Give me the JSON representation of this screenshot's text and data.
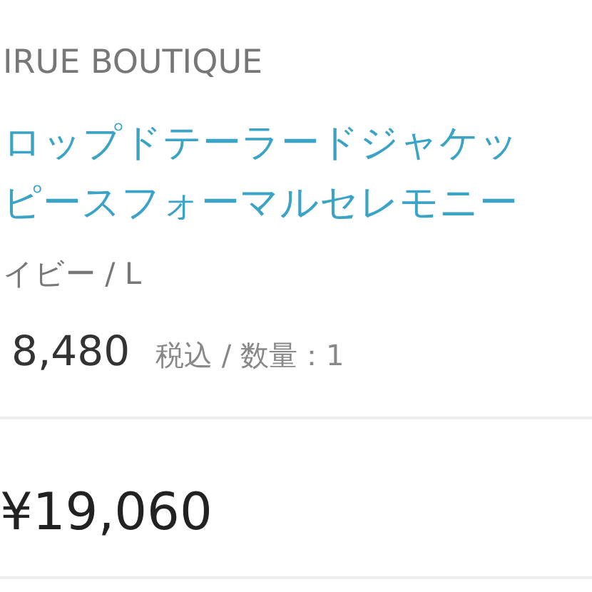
{
  "item": {
    "brand": "IRUE BOUTIQUE",
    "title_lines": [
      "ロップドテーラードジャケッ",
      "ピースフォーマルセレモニー"
    ],
    "variant": "イビー / L",
    "price": "8,480",
    "price_note": "税込 / 数量：1"
  },
  "total": {
    "amount": "¥19,060"
  }
}
